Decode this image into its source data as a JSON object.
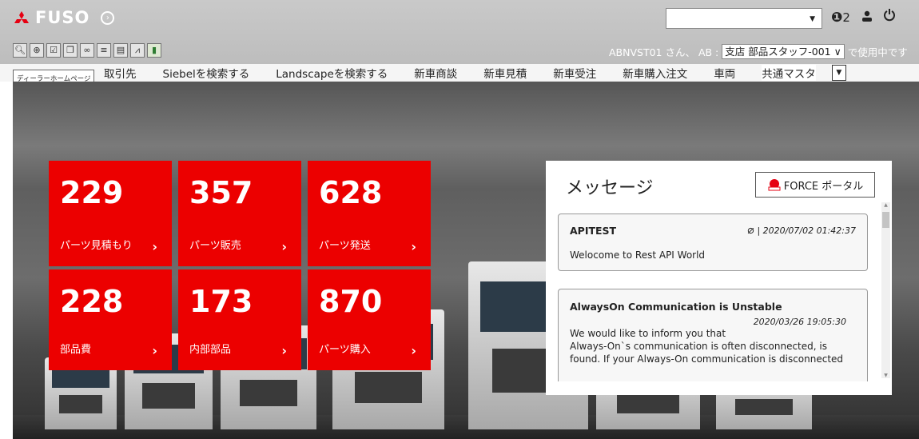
{
  "brand": {
    "name": "FUSO",
    "accent_color": "#ec0000"
  },
  "header": {
    "notification_count": "2",
    "user_line_prefix": "ABNVST01 さん、 AB :",
    "staff_role": "支店 部品スタッフ-001",
    "user_line_suffix": "で使用中です"
  },
  "nav": {
    "home_tooltip": "ディーラーホームページ",
    "items": [
      "取引先",
      "Siebelを検索する",
      "Landscapeを検索する",
      "新車商談",
      "新車見積",
      "新車受注",
      "新車購入注文",
      "車両",
      "共通マスタ"
    ]
  },
  "tiles": [
    {
      "value": "229",
      "label": "パーツ見積もり"
    },
    {
      "value": "357",
      "label": "パーツ販売"
    },
    {
      "value": "628",
      "label": "パーツ発送"
    },
    {
      "value": "228",
      "label": "部品費"
    },
    {
      "value": "173",
      "label": "内部部品"
    },
    {
      "value": "870",
      "label": "パーツ購入"
    }
  ],
  "messages_panel": {
    "title": "メッセージ",
    "portal_button": "FORCE ポータル",
    "messages": [
      {
        "title": "APITEST",
        "date": "| 2020/07/02 01:42:37",
        "body": "Welocome to Rest API World"
      },
      {
        "title": "AlwaysOn Communication is Unstable",
        "date": "2020/03/26 19:05:30",
        "body_lines": [
          "We would like to inform you that",
          "Always-On`s communication is often disconnected, is",
          "found. If your Always-On communication is disconnected"
        ]
      }
    ]
  },
  "icons": [
    "search-icon",
    "forward-icon",
    "checklist-icon",
    "copy-icon",
    "link-icon",
    "list-icon",
    "document-icon",
    "chart-icon",
    "bar-chart-icon",
    "chat-icon",
    "user-icon",
    "power-icon"
  ]
}
